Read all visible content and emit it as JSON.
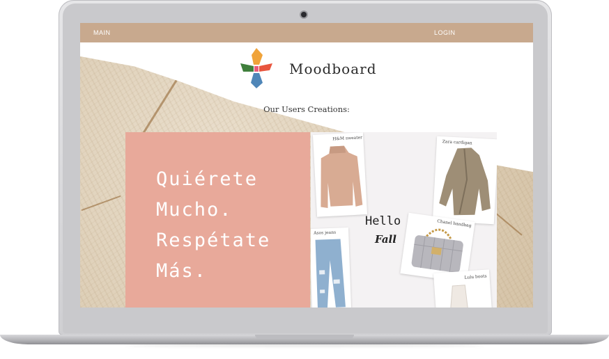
{
  "nav": {
    "main_label": "MAIN",
    "login_label": "LOGIN"
  },
  "brand": {
    "name": "Moodboard"
  },
  "section": {
    "title": "Our Users Creations:"
  },
  "quote": {
    "lines": [
      "Quiérete",
      "Mucho.",
      "Respétate",
      "Más."
    ]
  },
  "collage": {
    "items": [
      {
        "label": "H&M sweater"
      },
      {
        "label": "Zara cardigan"
      },
      {
        "label": "Asos jeans"
      },
      {
        "label": "Chanel handbag"
      },
      {
        "label": "Lulu boots"
      }
    ],
    "hello": "Hello",
    "fall": "Fall"
  },
  "colors": {
    "nav": "#c8a98e",
    "quote_panel": "#e8a99a"
  }
}
